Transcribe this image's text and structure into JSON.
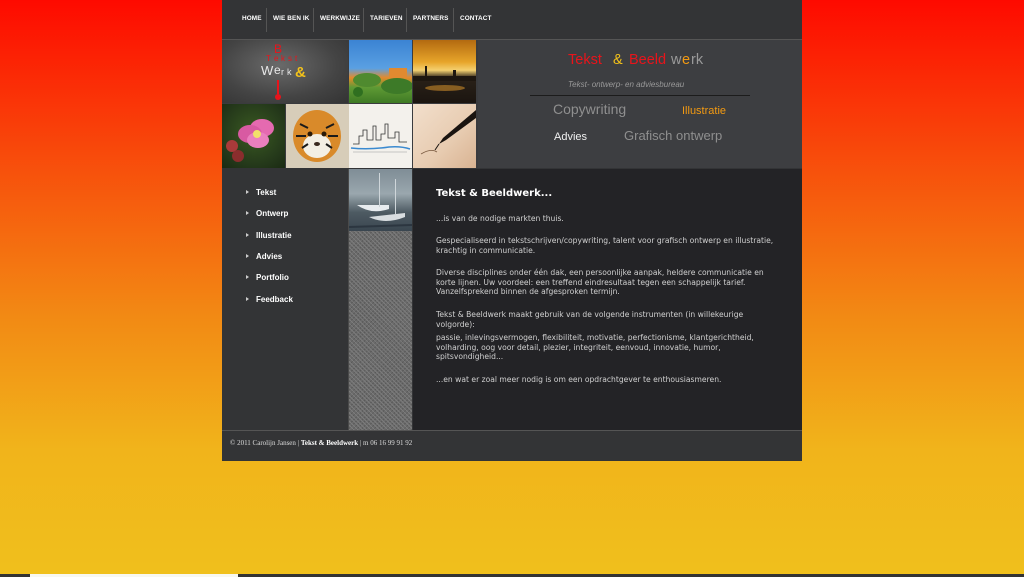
{
  "nav": {
    "items": [
      "HOME",
      "WIE BEN IK",
      "WERKWIJZE",
      "TARIEVEN",
      "PARTNERS",
      "CONTACT"
    ]
  },
  "logo": {
    "letters": [
      "B",
      "T",
      "e",
      "k",
      "s",
      "t",
      "W",
      "e",
      "r",
      "k",
      "&"
    ]
  },
  "brand": {
    "title_parts": [
      "Tekst",
      "&",
      "Beeld",
      "w",
      "e",
      "rk"
    ],
    "tagline": "Tekst- ontwerp- en adviesbureau",
    "services": [
      "Copywriting",
      "Illustratie",
      "Advies",
      "Grafisch ontwerp"
    ],
    "colors": {
      "red": "#e8141b",
      "orange": "#f39a12",
      "grey": "#9a9a9a",
      "white": "#ffffff"
    }
  },
  "sidebar": {
    "items": [
      "Tekst",
      "Ontwerp",
      "Illustratie",
      "Advies",
      "Portfolio",
      "Feedback"
    ]
  },
  "main": {
    "heading": "Tekst & Beeldwerk...",
    "paragraphs": [
      "...is van de nodige markten thuis.",
      "Gespecialiseerd in tekstschrijven/copywriting, talent voor grafisch ontwerp en illustratie, krachtig in communicatie.",
      "Diverse disciplines onder één dak, een persoonlijke aanpak, heldere communicatie en korte lijnen. Uw voordeel: een treffend eindresultaat tegen een schappelijk tarief. Vanzelfsprekend binnen de afgesproken termijn.",
      "Tekst & Beeldwerk maakt gebruik van de volgende instrumenten (in willekeurige volgorde):",
      "passie, inlevingsvermogen, flexibiliteit, motivatie, perfectionisme, klantgerichtheid, volharding, oog voor detail, plezier, integriteit, eenvoud, innovatie, humor, spitsvondigheid...",
      "...en wat er zoal meer nodig is om een opdrachtgever te enthousiasmeren."
    ]
  },
  "footer": {
    "copyright": "© 2011 Carolijn Jansen |",
    "brand": "Tekst & Beeldwerk",
    "phone": "| m 06 16 99 91 92"
  }
}
